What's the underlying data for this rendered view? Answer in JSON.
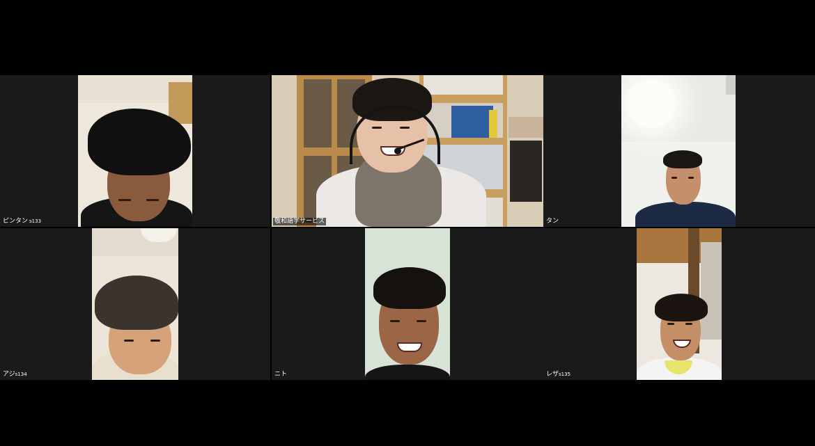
{
  "meeting": {
    "participants": [
      {
        "id": "p1",
        "name": "ピンタン",
        "suffix": "s133"
      },
      {
        "id": "p2",
        "name": "敬和語学サービス",
        "suffix": ""
      },
      {
        "id": "p3",
        "name": "タン",
        "suffix": ""
      },
      {
        "id": "p4",
        "name": "アジ",
        "suffix": "s134"
      },
      {
        "id": "p5",
        "name": "ニト",
        "suffix": ""
      },
      {
        "id": "p6",
        "name": "レザ",
        "suffix": "s135"
      }
    ]
  },
  "colors": {
    "background": "#000000",
    "tile": "#1a1a1a",
    "label_text": "#ffffff"
  }
}
